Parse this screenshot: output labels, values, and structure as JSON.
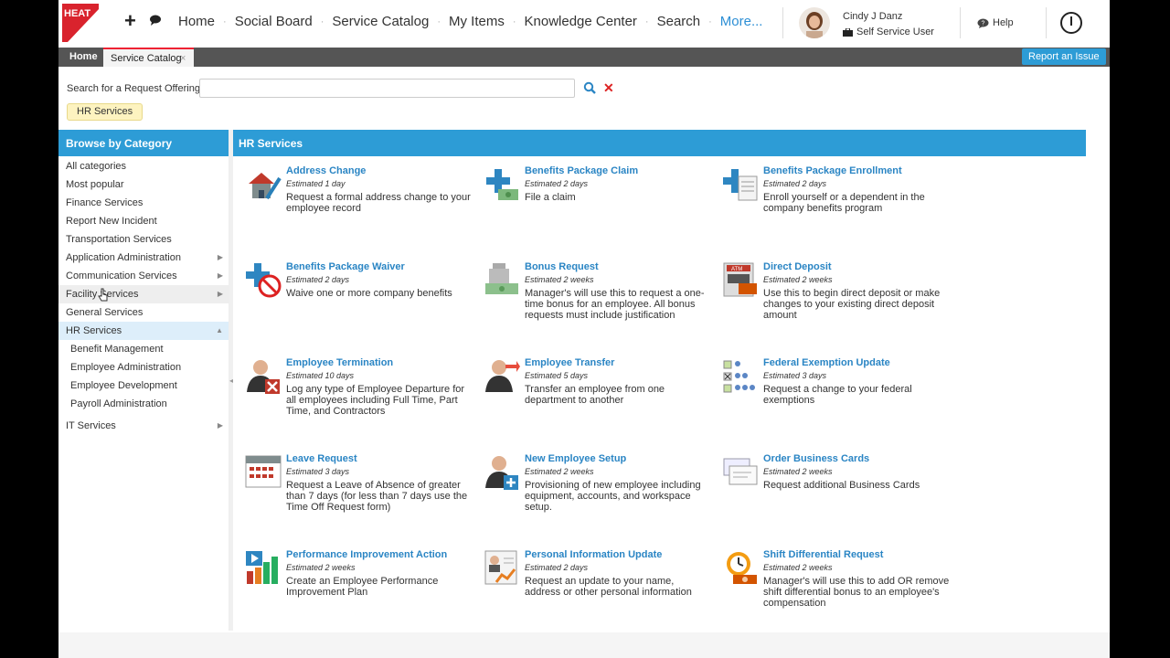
{
  "brand": {
    "logo_text": "HEAT",
    "logo_color": "#d9232d"
  },
  "topnav": {
    "links": [
      "Home",
      "Social Board",
      "Service Catalog",
      "My Items",
      "Knowledge Center",
      "Search",
      "More..."
    ],
    "user_name": "Cindy J Danz",
    "user_role": "Self Service User",
    "help_label": "Help"
  },
  "tabs": {
    "home": "Home",
    "service_catalog": "Service Catalog",
    "close_glyph": "×",
    "report_issue": "Report an Issue"
  },
  "search": {
    "label": "Search for a Request Offering:",
    "value": "",
    "placeholder": ""
  },
  "filter_chip": "HR Services",
  "sidebar": {
    "title": "Browse by Category",
    "items": [
      {
        "label": "All categories"
      },
      {
        "label": "Most popular"
      },
      {
        "label": "Finance Services"
      },
      {
        "label": "Report New Incident"
      },
      {
        "label": "Transportation Services"
      },
      {
        "label": "Application Administration",
        "arrow": "▶"
      },
      {
        "label": "Communication Services",
        "arrow": "▶"
      },
      {
        "label": "Facility Services",
        "arrow": "▶"
      },
      {
        "label": "General Services"
      },
      {
        "label": "HR Services",
        "arrow": "▲"
      },
      {
        "label": "Benefit Management"
      },
      {
        "label": "Employee Administration"
      },
      {
        "label": "Employee Development"
      },
      {
        "label": "Payroll Administration"
      },
      {
        "label": "IT Services",
        "arrow": "▶"
      }
    ]
  },
  "main": {
    "title": "HR Services",
    "offerings": [
      {
        "title": "Address Change",
        "estimate": "Estimated 1 day",
        "desc": "Request a formal address change to your employee record",
        "icon": "house-pencil-icon"
      },
      {
        "title": "Benefits Package Claim",
        "estimate": "Estimated 2 days",
        "desc": "File a claim",
        "icon": "medical-money-icon"
      },
      {
        "title": "Benefits Package Enrollment",
        "estimate": "Estimated 2 days",
        "desc": "Enroll yourself or a dependent in the company benefits program",
        "icon": "medical-form-icon"
      },
      {
        "title": "Benefits Package Waiver",
        "estimate": "Estimated 2 days",
        "desc": "Waive one or more company benefits",
        "icon": "medical-prohibited-icon"
      },
      {
        "title": "Bonus Request",
        "estimate": "Estimated 2 weeks",
        "desc": "Manager's will use this to request a one-time bonus for an employee. All bonus requests must include justification",
        "icon": "money-stack-icon"
      },
      {
        "title": "Direct Deposit",
        "estimate": "Estimated 2 weeks",
        "desc": "Use this to begin direct deposit or make changes to your existing direct deposit amount",
        "icon": "atm-icon"
      },
      {
        "title": "Employee Termination",
        "estimate": "Estimated 10 days",
        "desc": "Log any type of Employee Departure for all employees including Full Time, Part Time, and Contractors",
        "icon": "person-remove-icon"
      },
      {
        "title": "Employee Transfer",
        "estimate": "Estimated 5 days",
        "desc": "Transfer an employee from one department to another",
        "icon": "person-transfer-icon"
      },
      {
        "title": "Federal Exemption Update",
        "estimate": "Estimated 3 days",
        "desc": "Request a change to your federal exemptions",
        "icon": "exemption-checklist-icon"
      },
      {
        "title": "Leave Request",
        "estimate": "Estimated 3 days",
        "desc": "Request a Leave of Absence of greater than 7 days (for less than 7 days use the Time Off Request form)",
        "icon": "calendar-icon"
      },
      {
        "title": "New Employee Setup",
        "estimate": "Estimated 2 weeks",
        "desc": "Provisioning of new employee including equipment, accounts, and workspace setup.",
        "icon": "person-add-icon"
      },
      {
        "title": "Order Business Cards",
        "estimate": "Estimated 2 weeks",
        "desc": "Request additional Business Cards",
        "icon": "business-cards-icon"
      },
      {
        "title": "Performance Improvement Action",
        "estimate": "Estimated 2 weeks",
        "desc": "Create an Employee Performance Improvement Plan",
        "icon": "performance-chart-icon"
      },
      {
        "title": "Personal Information Update",
        "estimate": "Estimated 2 days",
        "desc": "Request an update to your name, address or other personal information",
        "icon": "personal-info-icon"
      },
      {
        "title": "Shift Differential Request",
        "estimate": "Estimated 2 weeks",
        "desc": "Manager's will use this to add OR remove shift differential bonus to an employee's compensation",
        "icon": "shift-clock-icon"
      }
    ]
  },
  "colors": {
    "accent": "#2d9cd6",
    "link": "#2a85c4",
    "tabbar": "#555555",
    "chip_bg": "#fdf3c0"
  }
}
